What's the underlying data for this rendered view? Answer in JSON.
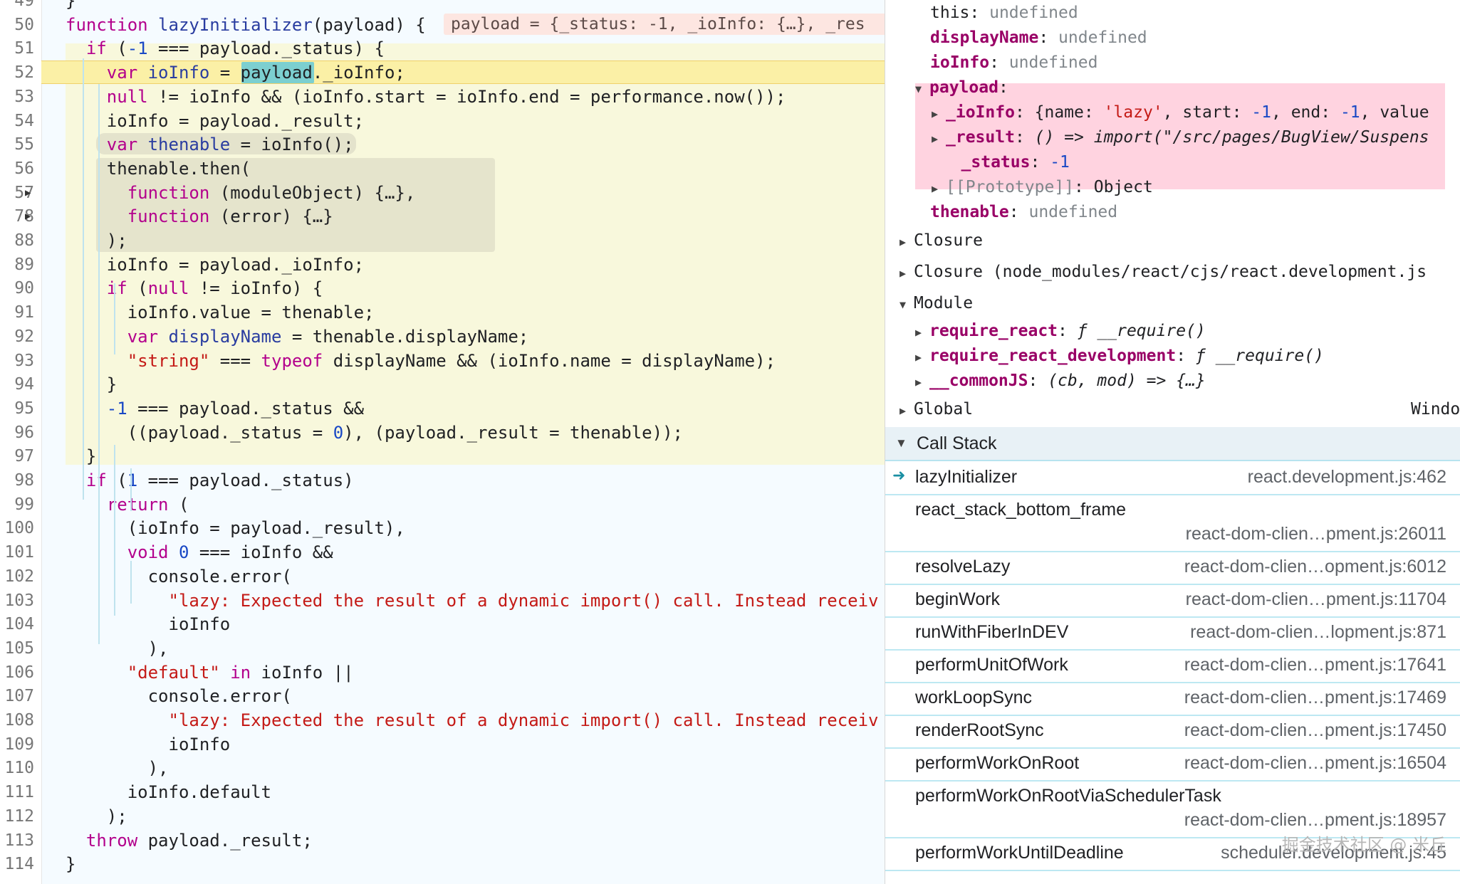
{
  "editor": {
    "inline_value": "payload = {_status: -1, _ioInfo: {…}, _res",
    "lines": [
      {
        "n": "49",
        "tokens": [
          {
            "t": "}",
            "c": "pl"
          }
        ]
      },
      {
        "n": "50",
        "tokens": [
          {
            "t": "function ",
            "c": "kw"
          },
          {
            "t": "lazyInitializer",
            "c": "fn"
          },
          {
            "t": "(payload) {",
            "c": "pl"
          }
        ]
      },
      {
        "n": "51",
        "tokens": [
          {
            "t": "  if ",
            "c": "kw"
          },
          {
            "t": "(",
            "c": "pl"
          },
          {
            "t": "-1",
            "c": "num"
          },
          {
            "t": " === payload._status) {",
            "c": "pl"
          }
        ]
      },
      {
        "n": "52",
        "tokens": [
          {
            "t": "    var ",
            "c": "kw"
          },
          {
            "t": "ioInfo",
            "c": "fn"
          },
          {
            "t": " = ",
            "c": "pl"
          },
          {
            "t": "payload",
            "c": "pl"
          },
          {
            "t": "._ioInfo;",
            "c": "pl"
          }
        ]
      },
      {
        "n": "53",
        "tokens": [
          {
            "t": "    null",
            "c": "kw"
          },
          {
            "t": " != ioInfo && (ioInfo.start = ioInfo.end = performance.now());",
            "c": "pl"
          }
        ]
      },
      {
        "n": "54",
        "tokens": [
          {
            "t": "    ioInfo = payload._result;",
            "c": "pl"
          }
        ]
      },
      {
        "n": "55",
        "tokens": [
          {
            "t": "    var ",
            "c": "kw"
          },
          {
            "t": "thenable",
            "c": "fn"
          },
          {
            "t": " = ioInfo();",
            "c": "pl"
          }
        ]
      },
      {
        "n": "56",
        "tokens": [
          {
            "t": "    thenable.then(",
            "c": "pl"
          }
        ]
      },
      {
        "n": "57",
        "tokens": [
          {
            "t": "      function ",
            "c": "kw"
          },
          {
            "t": "(moduleObject) {…},",
            "c": "pl"
          }
        ]
      },
      {
        "n": "78",
        "tokens": [
          {
            "t": "      function ",
            "c": "kw"
          },
          {
            "t": "(error) {…}",
            "c": "pl"
          }
        ]
      },
      {
        "n": "88",
        "tokens": [
          {
            "t": "    );",
            "c": "pl"
          }
        ]
      },
      {
        "n": "89",
        "tokens": [
          {
            "t": "    ioInfo = payload._ioInfo;",
            "c": "pl"
          }
        ]
      },
      {
        "n": "90",
        "tokens": [
          {
            "t": "    if ",
            "c": "kw"
          },
          {
            "t": "(",
            "c": "pl"
          },
          {
            "t": "null",
            "c": "kw"
          },
          {
            "t": " != ioInfo) {",
            "c": "pl"
          }
        ]
      },
      {
        "n": "91",
        "tokens": [
          {
            "t": "      ioInfo.value = thenable;",
            "c": "pl"
          }
        ]
      },
      {
        "n": "92",
        "tokens": [
          {
            "t": "      var ",
            "c": "kw"
          },
          {
            "t": "displayName",
            "c": "fn"
          },
          {
            "t": " = thenable.displayName;",
            "c": "pl"
          }
        ]
      },
      {
        "n": "93",
        "tokens": [
          {
            "t": "      ",
            "c": "pl"
          },
          {
            "t": "\"string\"",
            "c": "str"
          },
          {
            "t": " === ",
            "c": "pl"
          },
          {
            "t": "typeof",
            "c": "kw"
          },
          {
            "t": " displayName && (ioInfo.name = displayName);",
            "c": "pl"
          }
        ]
      },
      {
        "n": "94",
        "tokens": [
          {
            "t": "    }",
            "c": "pl"
          }
        ]
      },
      {
        "n": "95",
        "tokens": [
          {
            "t": "    ",
            "c": "pl"
          },
          {
            "t": "-1",
            "c": "num"
          },
          {
            "t": " === payload._status &&",
            "c": "pl"
          }
        ]
      },
      {
        "n": "96",
        "tokens": [
          {
            "t": "      ((payload._status = ",
            "c": "pl"
          },
          {
            "t": "0",
            "c": "num"
          },
          {
            "t": "), (payload._result = thenable));",
            "c": "pl"
          }
        ]
      },
      {
        "n": "97",
        "tokens": [
          {
            "t": "  }",
            "c": "pl"
          }
        ]
      },
      {
        "n": "98",
        "tokens": [
          {
            "t": "  if ",
            "c": "kw"
          },
          {
            "t": "(",
            "c": "pl"
          },
          {
            "t": "1",
            "c": "num"
          },
          {
            "t": " === payload._status)",
            "c": "pl"
          }
        ]
      },
      {
        "n": "99",
        "tokens": [
          {
            "t": "    return ",
            "c": "kw"
          },
          {
            "t": "(",
            "c": "pl"
          }
        ]
      },
      {
        "n": "100",
        "tokens": [
          {
            "t": "      (ioInfo = payload._result),",
            "c": "pl"
          }
        ]
      },
      {
        "n": "101",
        "tokens": [
          {
            "t": "      void ",
            "c": "kw"
          },
          {
            "t": "0",
            "c": "num"
          },
          {
            "t": " === ioInfo &&",
            "c": "pl"
          }
        ]
      },
      {
        "n": "102",
        "tokens": [
          {
            "t": "        console.error(",
            "c": "pl"
          }
        ]
      },
      {
        "n": "103",
        "tokens": [
          {
            "t": "          ",
            "c": "pl"
          },
          {
            "t": "\"lazy: Expected the result of a dynamic import() call. Instead receiv",
            "c": "str"
          }
        ]
      },
      {
        "n": "104",
        "tokens": [
          {
            "t": "          ioInfo",
            "c": "pl"
          }
        ]
      },
      {
        "n": "105",
        "tokens": [
          {
            "t": "        ),",
            "c": "pl"
          }
        ]
      },
      {
        "n": "106",
        "tokens": [
          {
            "t": "      ",
            "c": "pl"
          },
          {
            "t": "\"default\"",
            "c": "str"
          },
          {
            "t": " in ",
            "c": "kw"
          },
          {
            "t": "ioInfo ||",
            "c": "pl"
          }
        ]
      },
      {
        "n": "107",
        "tokens": [
          {
            "t": "        console.error(",
            "c": "pl"
          }
        ]
      },
      {
        "n": "108",
        "tokens": [
          {
            "t": "          ",
            "c": "pl"
          },
          {
            "t": "\"lazy: Expected the result of a dynamic import() call. Instead receiv",
            "c": "str"
          }
        ]
      },
      {
        "n": "109",
        "tokens": [
          {
            "t": "          ioInfo",
            "c": "pl"
          }
        ]
      },
      {
        "n": "110",
        "tokens": [
          {
            "t": "        ),",
            "c": "pl"
          }
        ]
      },
      {
        "n": "111",
        "tokens": [
          {
            "t": "      ioInfo.default",
            "c": "pl"
          }
        ]
      },
      {
        "n": "112",
        "tokens": [
          {
            "t": "    );",
            "c": "pl"
          }
        ]
      },
      {
        "n": "113",
        "tokens": [
          {
            "t": "  throw ",
            "c": "kw"
          },
          {
            "t": "payload._result;",
            "c": "pl"
          }
        ]
      },
      {
        "n": "114",
        "tokens": [
          {
            "t": "}",
            "c": "pl"
          }
        ]
      }
    ]
  },
  "scope": {
    "local": [
      {
        "key": "this",
        "val": "undefined"
      },
      {
        "key": "displayName",
        "val": "undefined"
      },
      {
        "key": "ioInfo",
        "val": "undefined"
      }
    ],
    "payload_key": "payload",
    "payload_children": [
      {
        "key": "_ioInfo",
        "val_parts": [
          "{name: ",
          "'lazy'",
          ", start: ",
          "-1",
          ", end: ",
          "-1",
          ", value"
        ]
      },
      {
        "key": "_result",
        "val": "() => import(\"/src/pages/BugView/Suspens"
      },
      {
        "key": "_status",
        "val": "-1"
      },
      {
        "key": "[[Prototype]]",
        "val": "Object"
      }
    ],
    "thenable": {
      "key": "thenable",
      "val": "undefined"
    },
    "closure_1": "Closure",
    "closure_2": "Closure (node_modules/react/cjs/react.development.js",
    "module": "Module",
    "module_items": [
      {
        "key": "require_react",
        "val": "ƒ __require()"
      },
      {
        "key": "require_react_development",
        "val": "ƒ __require()"
      },
      {
        "key": "__commonJS",
        "val": "(cb, mod) => {…}"
      }
    ],
    "global": "Global",
    "global_val": "Windo"
  },
  "callstack": {
    "title": "Call Stack",
    "frames": [
      {
        "name": "lazyInitializer",
        "loc": "react.development.js:462",
        "current": true
      },
      {
        "name": "react_stack_bottom_frame",
        "loc": "react-dom-clien…pment.js:26011",
        "wrap": true
      },
      {
        "name": "resolveLazy",
        "loc": "react-dom-clien…opment.js:6012"
      },
      {
        "name": "beginWork",
        "loc": "react-dom-clien…pment.js:11704"
      },
      {
        "name": "runWithFiberInDEV",
        "loc": "react-dom-clien…lopment.js:871"
      },
      {
        "name": "performUnitOfWork",
        "loc": "react-dom-clien…pment.js:17641"
      },
      {
        "name": "workLoopSync",
        "loc": "react-dom-clien…pment.js:17469"
      },
      {
        "name": "renderRootSync",
        "loc": "react-dom-clien…pment.js:17450"
      },
      {
        "name": "performWorkOnRoot",
        "loc": "react-dom-clien…pment.js:16504"
      },
      {
        "name": "performWorkOnRootViaSchedulerTask",
        "loc": "react-dom-clien…pment.js:18957",
        "wrap": true
      },
      {
        "name": "performWorkUntilDeadline",
        "loc": "scheduler.development.js:45"
      }
    ]
  },
  "watermark": "掘金技术社区 @ 米丘"
}
